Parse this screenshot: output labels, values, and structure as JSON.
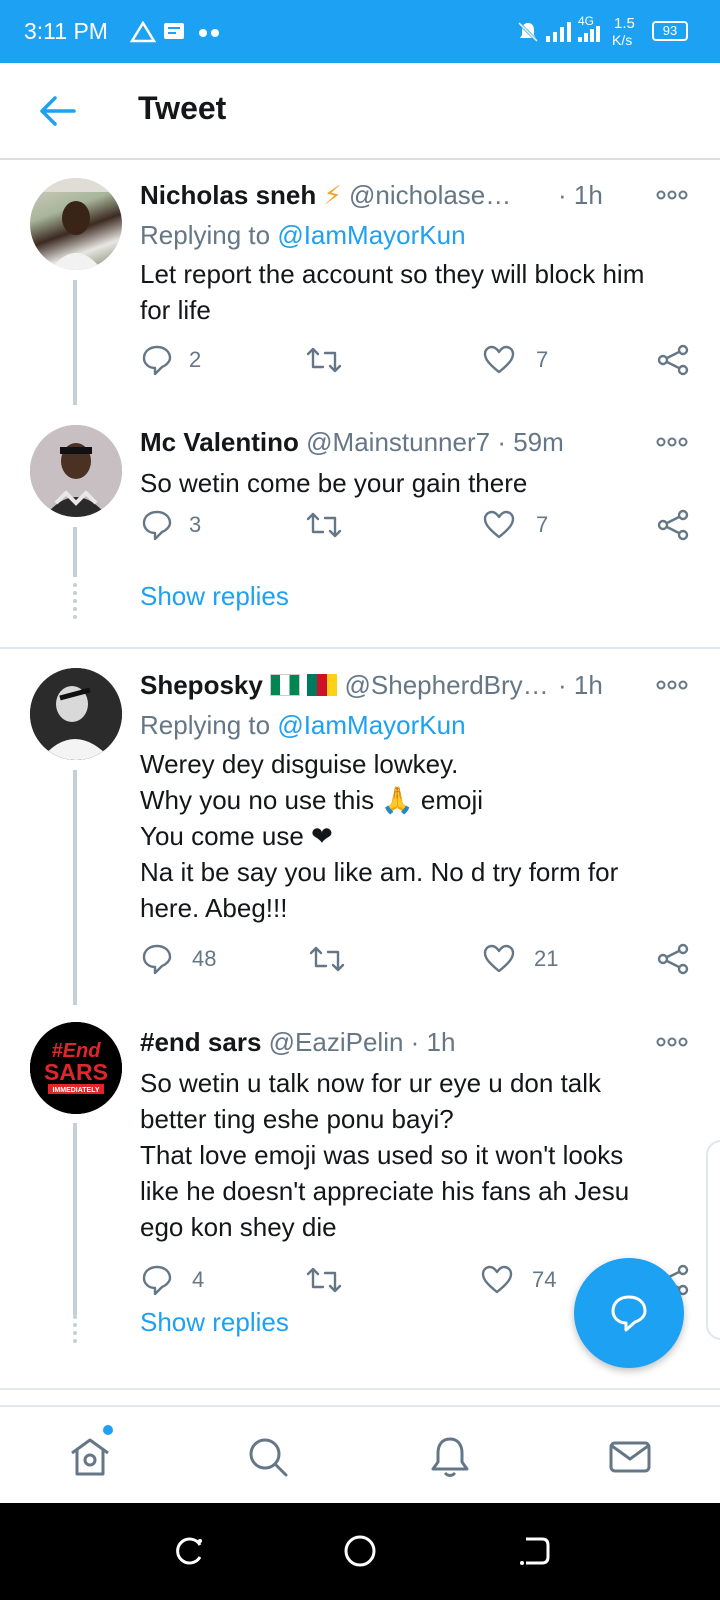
{
  "status_bar": {
    "time": "3:11 PM",
    "network": "4G",
    "speed": "1.5",
    "speed_unit": "K/s",
    "battery": "93"
  },
  "header": {
    "title": "Tweet"
  },
  "tweets": [
    {
      "name": "Nicholas sneh",
      "badge": "⚡",
      "handle": "@nicholase…",
      "time": "· 1h",
      "replying_label": "Replying to",
      "replying_to": "@IamMayorKun",
      "lines": [
        "Let report the account so they will block him",
        "for life"
      ],
      "replies": "2",
      "retweets": "",
      "likes": "7"
    },
    {
      "name": "Mc Valentino",
      "handle": "@Mainstunner7",
      "time": "· 59m",
      "lines": [
        "So wetin come be your gain there"
      ],
      "replies": "3",
      "retweets": "",
      "likes": "7"
    },
    {
      "name": "Sheposky",
      "handle": "@ShepherdBry…",
      "time": "· 1h",
      "replying_label": "Replying to",
      "replying_to": "@IamMayorKun",
      "lines": [
        "Werey dey disguise lowkey.",
        "Why you no use this 🙏 emoji",
        "You come use ❤",
        "Na it be say you like am. No d try form for",
        "here. Abeg!!!"
      ],
      "replies": "48",
      "retweets": "",
      "likes": "21"
    },
    {
      "name": "#end sars",
      "handle": "@EaziPelin",
      "time": "· 1h",
      "lines": [
        "So wetin u talk now for ur eye u don talk",
        "better ting eshe ponu bayi?",
        "That love emoji was used so it won't looks",
        "like he doesn't appreciate his fans ah Jesu",
        "ego kon shey die"
      ],
      "replies": "4",
      "retweets": "",
      "likes": "74"
    }
  ],
  "avatar_text": {
    "line1": "#End",
    "line2": "SARS",
    "line3": "IMMEDIATELY"
  },
  "show_replies_label": "Show replies",
  "icons": {
    "back": "arrow-left-icon",
    "reply": "reply-bubble-icon",
    "retweet": "retweet-icon",
    "like": "heart-icon",
    "share": "share-icon",
    "more": "more-dots-icon",
    "fab": "compose-reply-icon",
    "nav": [
      "home-icon",
      "search-icon",
      "notifications-icon",
      "messages-icon"
    ]
  },
  "colors": {
    "brand": "#1da1f2",
    "text": "#14171a",
    "muted": "#657786",
    "border": "#e1e8ed"
  }
}
